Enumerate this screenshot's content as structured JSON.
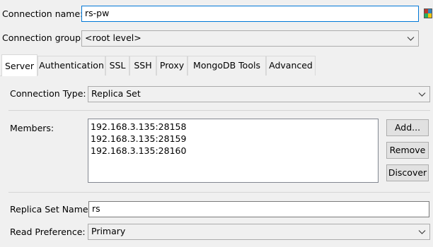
{
  "connection": {
    "name_label": "Connection name:",
    "name_value": "rs-pw",
    "group_label": "Connection group:",
    "group_value": "<root level>"
  },
  "tabs": [
    {
      "label": "Server",
      "active": true
    },
    {
      "label": "Authentication",
      "active": false
    },
    {
      "label": "SSL",
      "active": false
    },
    {
      "label": "SSH",
      "active": false
    },
    {
      "label": "Proxy",
      "active": false
    },
    {
      "label": "MongoDB Tools",
      "active": false
    },
    {
      "label": "Advanced",
      "active": false
    }
  ],
  "server": {
    "connection_type_label": "Connection Type:",
    "connection_type_value": "Replica Set",
    "members_label": "Members:",
    "members": [
      "192.168.3.135:28158",
      "192.168.3.135:28159",
      "192.168.3.135:28160"
    ],
    "add_label": "Add...",
    "remove_label": "Remove",
    "discover_label": "Discover",
    "replica_set_name_label": "Replica Set Name:",
    "replica_set_name_value": "rs",
    "read_preference_label": "Read Preference:",
    "read_preference_value": "Primary"
  },
  "icons": {
    "palette": "color-palette-icon",
    "dropdown": "chevron-down-icon"
  },
  "colors": {
    "focus_border": "#0078d7",
    "panel_bg": "#f0f0f0",
    "active_tab_bg": "#ffffff"
  }
}
